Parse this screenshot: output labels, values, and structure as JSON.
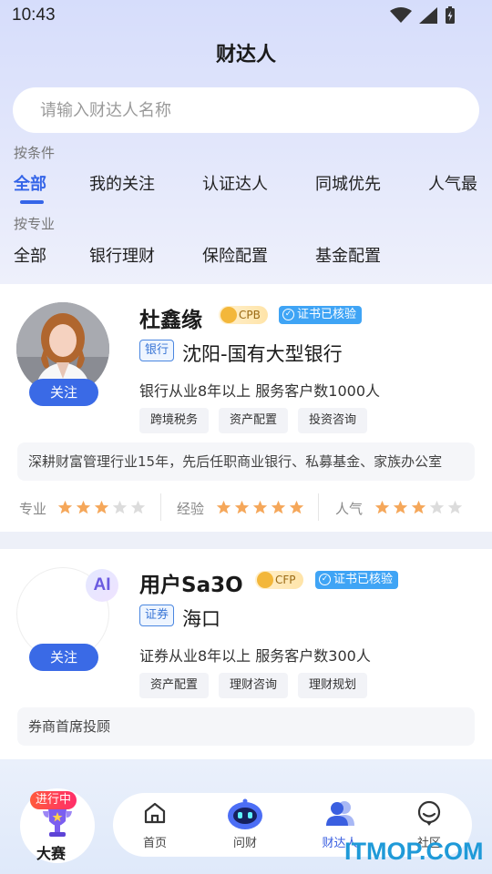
{
  "status": {
    "time": "10:43"
  },
  "header": {
    "title": "财达人"
  },
  "search": {
    "placeholder": "请输入财达人名称"
  },
  "filters": {
    "condition_label": "按条件",
    "condition_tabs": [
      "全部",
      "我的关注",
      "认证达人",
      "同城优先",
      "人气最"
    ],
    "specialty_label": "按专业",
    "specialty_tabs": [
      "全部",
      "银行理财",
      "保险配置",
      "基金配置"
    ]
  },
  "advisors": [
    {
      "name": "杜鑫缘",
      "cert": "CPB",
      "verified": "证书已核验",
      "type": "银行",
      "org": "沈阳-国有大型银行",
      "experience": "银行从业8年以上",
      "clients": "服务客户数1000人",
      "tags": [
        "跨境税务",
        "资产配置",
        "投资咨询"
      ],
      "description": "深耕财富管理行业15年，先后任职商业银行、私募基金、家族办公室",
      "follow": "关注",
      "ratings": [
        {
          "label": "专业",
          "stars": 3
        },
        {
          "label": "经验",
          "stars": 5
        },
        {
          "label": "人气",
          "stars": 3
        }
      ]
    },
    {
      "name": "用户Sa3O",
      "cert": "CFP",
      "verified": "证书已核验",
      "type": "证券",
      "org": "海口",
      "experience": "证券从业8年以上",
      "clients": "服务客户数300人",
      "tags": [
        "资产配置",
        "理财咨询",
        "理财规划"
      ],
      "description": "券商首席投顾",
      "follow": "关注",
      "avatar_badge": "AI"
    }
  ],
  "contest": {
    "live": "进行中",
    "label": "大赛"
  },
  "nav": [
    {
      "label": "首页",
      "icon": "home-icon"
    },
    {
      "label": "问财",
      "icon": "ai-robot-icon"
    },
    {
      "label": "财达人",
      "icon": "people-icon",
      "active": true
    },
    {
      "label": "社区",
      "icon": "chat-icon"
    }
  ],
  "colors": {
    "accent": "#3565e8",
    "star_on": "#f5a75a",
    "star_off": "#dcdcdc"
  },
  "watermark": "ITMOP.COM"
}
